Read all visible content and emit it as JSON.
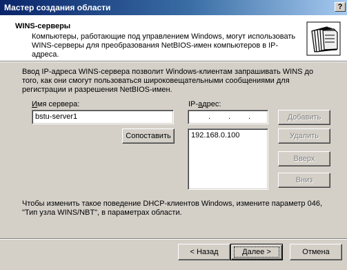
{
  "window": {
    "title": "Мастер создания области",
    "help_button": "?"
  },
  "header": {
    "title": "WINS-серверы",
    "description": "Компьютеры, работающие под управлением Windows, могут использовать WINS-серверы для преобразования NetBIOS-имен компьютеров в IP-адреса.",
    "icon": "folder-stack-icon"
  },
  "intro": "Ввод IP-адреса WINS-сервера позволит Windows-клиентам запрашивать WINS до того, как они смогут пользоваться широковещательными сообщениями для регистрации и разрешения NetBIOS-имен.",
  "server_name": {
    "label_prefix": "",
    "label_accel": "И",
    "label_rest": "мя сервера:",
    "value": "bstu-server1"
  },
  "resolve_button": "Сопоставить",
  "ip": {
    "label_prefix": "IP-",
    "label_accel": "а",
    "label_rest": "дрес:",
    "dot1": ".",
    "dot2": ".",
    "dot3": "."
  },
  "ip_list": [
    "192.168.0.100"
  ],
  "side_buttons": {
    "add": "Добавить",
    "remove": "Удалить",
    "up": "Вверх",
    "down": "Вниз"
  },
  "note": "Чтобы изменить такое поведение DHCP-клиентов Windows, измените параметр 046, \"Тип узла WINS/NBT\", в параметрах области.",
  "nav": {
    "back": "< Назад",
    "next": "Далее >",
    "cancel": "Отмена"
  }
}
